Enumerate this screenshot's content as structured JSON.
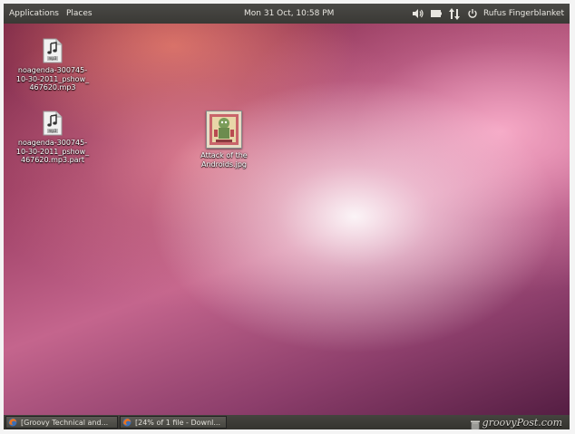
{
  "top_panel": {
    "menus": [
      "Applications",
      "Places"
    ],
    "clock": "Mon 31 Oct, 10:58 PM",
    "user": "Rufus Fingerblanket",
    "tray_icons": [
      "volume-icon",
      "battery-icon",
      "network-icon",
      "power-icon"
    ]
  },
  "desktop": {
    "icons": [
      {
        "label": "noagenda-300745-\n10-30-2011_pshow_\n467620.mp3",
        "type": "audio-file",
        "badge": "mp3"
      },
      {
        "label": "noagenda-300745-\n10-30-2011_pshow_\n467620.mp3.part",
        "type": "audio-file",
        "badge": "mp3"
      },
      {
        "label": "Attack of the\nAndroids.jpg",
        "type": "image-file"
      }
    ]
  },
  "taskbar": {
    "tasks": [
      {
        "label": "[Groovy Technical and..."
      },
      {
        "label": "[24% of 1 file - Downl..."
      }
    ]
  },
  "watermark": "groovyPost.com",
  "colors": {
    "panel": "#3c3b37",
    "accent": "#dd4814"
  }
}
